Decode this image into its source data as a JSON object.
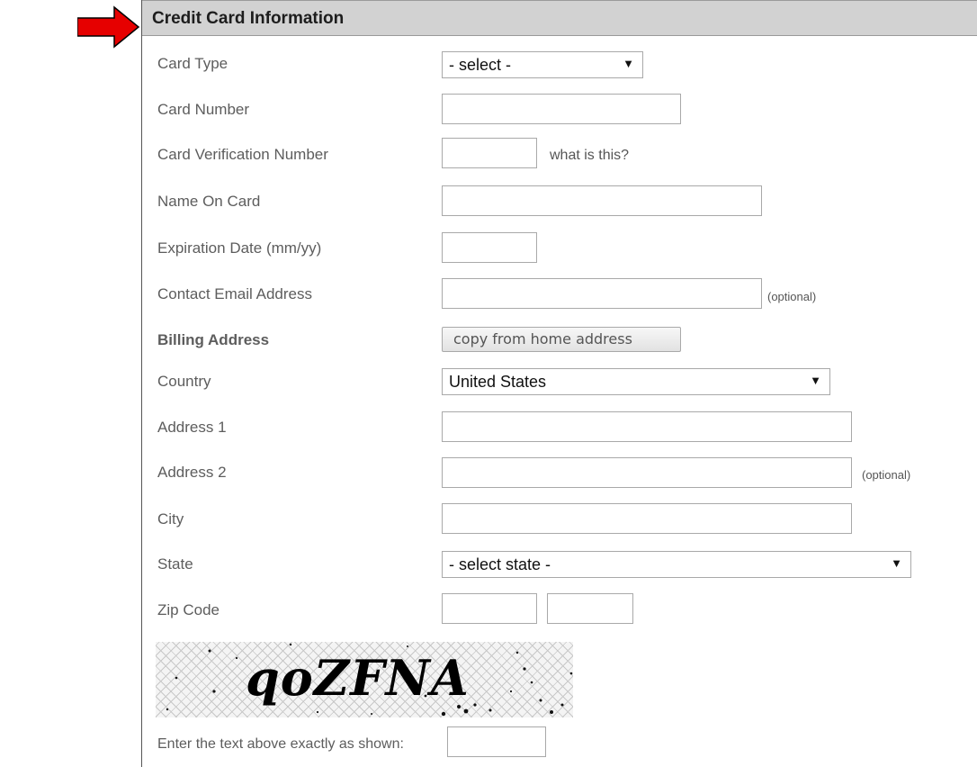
{
  "header": {
    "title": "Credit Card Information"
  },
  "fields": {
    "card_type": {
      "label": "Card Type",
      "value": "- select -"
    },
    "card_number": {
      "label": "Card Number"
    },
    "cvn": {
      "label": "Card Verification Number",
      "help": "what is this?"
    },
    "name_on_card": {
      "label": "Name On Card"
    },
    "expiration": {
      "label": "Expiration Date (mm/yy)"
    },
    "email": {
      "label": "Contact Email Address",
      "note": "(optional)"
    },
    "billing": {
      "label": "Billing Address",
      "button": "copy from home address"
    },
    "country": {
      "label": "Country",
      "value": "United States"
    },
    "address1": {
      "label": "Address 1"
    },
    "address2": {
      "label": "Address 2",
      "note": "(optional)"
    },
    "city": {
      "label": "City"
    },
    "state": {
      "label": "State",
      "value": "- select state -"
    },
    "zip": {
      "label": "Zip Code"
    }
  },
  "captcha": {
    "text": "qoZFNA",
    "prompt": "Enter the text above exactly as shown:"
  },
  "icons": {
    "arrow": "right-arrow-icon",
    "dropdown": "caret-down-icon"
  },
  "colors": {
    "arrow": "#e60000",
    "header_bg": "#d2d2d2"
  }
}
